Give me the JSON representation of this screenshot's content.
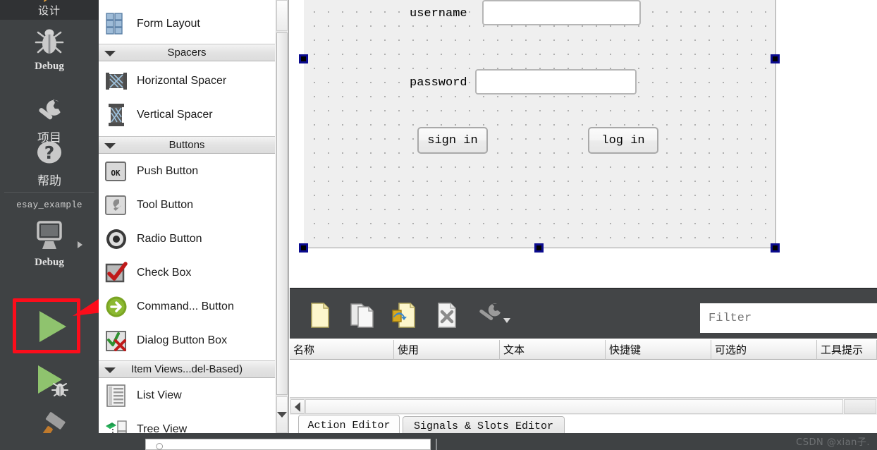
{
  "sidebar": {
    "title": "设计",
    "modes": [
      {
        "label": "Debug",
        "icon": "bug-icon",
        "cjk": false
      },
      {
        "label": "项目",
        "icon": "wrench-icon",
        "cjk": true
      },
      {
        "label": "帮助",
        "icon": "question-icon",
        "cjk": true
      }
    ],
    "kit_name": "esay_example",
    "build_config_label": "Debug",
    "run_button": "run-icon",
    "debug_button": "run-debug-icon",
    "build_button": "hammer-icon"
  },
  "widget_box": {
    "items": [
      {
        "label": "Form Layout",
        "icon": "form-layout-icon",
        "type": "item"
      },
      {
        "label": "Spacers",
        "type": "category"
      },
      {
        "label": "Horizontal Spacer",
        "icon": "horizontal-spacer-icon",
        "type": "item"
      },
      {
        "label": "Vertical Spacer",
        "icon": "vertical-spacer-icon",
        "type": "item"
      },
      {
        "label": "Buttons",
        "type": "category"
      },
      {
        "label": "Push Button",
        "icon": "push-button-icon",
        "type": "item"
      },
      {
        "label": "Tool Button",
        "icon": "tool-button-icon",
        "type": "item"
      },
      {
        "label": "Radio Button",
        "icon": "radio-button-icon",
        "type": "item"
      },
      {
        "label": "Check Box",
        "icon": "check-box-icon",
        "type": "item"
      },
      {
        "label": "Command... Button",
        "icon": "command-link-button-icon",
        "type": "item"
      },
      {
        "label": "Dialog Button Box",
        "icon": "dialog-button-box-icon",
        "type": "item"
      },
      {
        "label": "Item Views...del-Based)",
        "type": "category"
      },
      {
        "label": "List View",
        "icon": "list-view-icon",
        "type": "item"
      },
      {
        "label": "Tree View",
        "icon": "tree-view-icon",
        "type": "item"
      }
    ]
  },
  "form": {
    "label_username": "username",
    "label_password": "password",
    "button_signin": "sign in",
    "button_login": "log in",
    "lineedit_username_value": "",
    "lineedit_password_value": ""
  },
  "action_editor": {
    "toolbar": [
      {
        "name": "new-action-icon"
      },
      {
        "name": "copy-action-icon"
      },
      {
        "name": "paste-action-icon"
      },
      {
        "name": "delete-action-icon"
      },
      {
        "name": "configure-action-icon"
      }
    ],
    "filter_placeholder": "Filter",
    "filter_value": "",
    "columns": [
      "名称",
      "使用",
      "文本",
      "快捷键",
      "可选的",
      "工具提示"
    ],
    "rows": [],
    "tabs": [
      {
        "label": "Action Editor",
        "active": true
      },
      {
        "label": "Signals & Slots Editor",
        "active": false
      }
    ]
  },
  "watermark": "CSDN @xian子.",
  "colors": {
    "sidebar_bg": "#3f4244",
    "sidebar_title_bg": "#303234",
    "toolbar_bg": "#434547",
    "annotation_red": "#fc0d1b",
    "run_green": "#8fc36e",
    "selection_blue": "#0000e0",
    "canvas_bg": "#efefef"
  }
}
